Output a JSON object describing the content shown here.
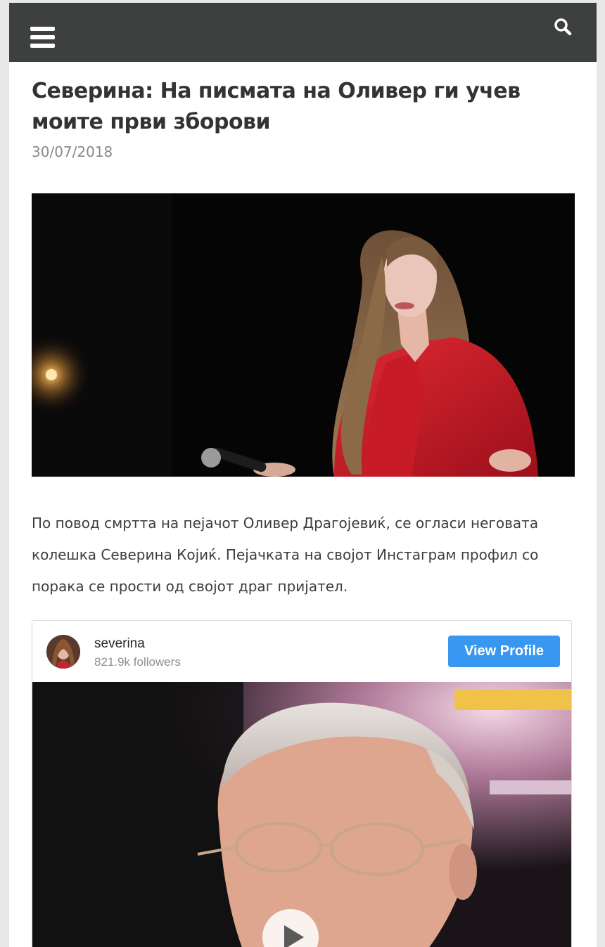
{
  "header": {
    "menu_icon": "hamburger-menu-icon",
    "search_icon": "search-icon",
    "background_color": "#3d403f"
  },
  "article": {
    "title": "Северина: На писмата на Оливер ги учев моите први зборови",
    "date": "30/07/2018",
    "body": "По повод смртта на пејачот Оливер Драгојевиќ, се огласи неговата колешка Северина Којиќ.  Пејачката на својот Инстаграм профил со порака се прости од својот драг пријател."
  },
  "instagram_embed": {
    "username": "severina",
    "followers": "821.9k followers",
    "view_profile_label": "View Profile",
    "button_color": "#3897f0",
    "play_icon": "play-icon"
  }
}
